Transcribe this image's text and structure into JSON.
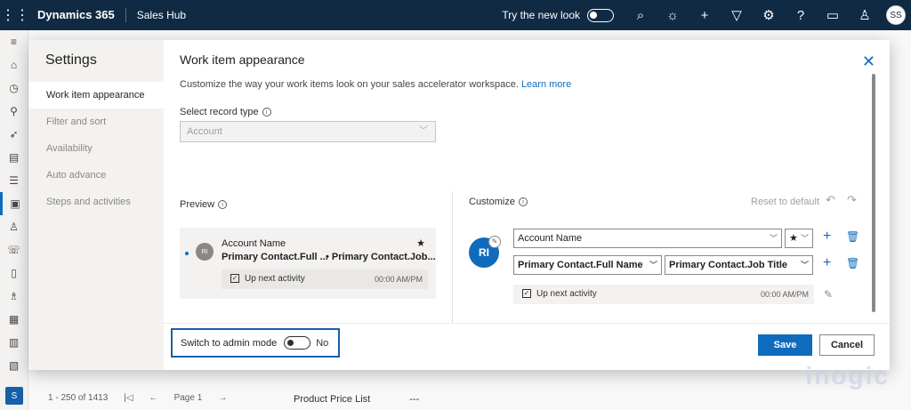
{
  "topbar": {
    "brand": "Dynamics 365",
    "app": "Sales Hub",
    "try_new_look": "Try the new look",
    "avatar": "SS",
    "icons": [
      "waffle-icon",
      "search-icon",
      "lightbulb-icon",
      "plus-icon",
      "filter-icon",
      "gear-icon",
      "help-icon",
      "chat-icon",
      "people-icon"
    ]
  },
  "leftnav": {
    "icons": [
      "hamburger-icon",
      "home-icon",
      "recent-icon",
      "pin-icon",
      "rocket-icon",
      "clipboard-icon",
      "list-icon",
      "workspace-icon",
      "person-icon",
      "phone-icon",
      "document-icon",
      "contact-icon",
      "report-icon",
      "doc-icon",
      "doc2-icon"
    ],
    "badge": "S"
  },
  "background": {
    "pager_count": "1 - 250 of 1413",
    "page": "Page 1",
    "field_label": "Product Price List",
    "field_value": "---"
  },
  "settings": {
    "title": "Settings",
    "items": [
      {
        "label": "Work item appearance",
        "active": true
      },
      {
        "label": "Filter and sort",
        "active": false
      },
      {
        "label": "Availability",
        "active": false
      },
      {
        "label": "Auto advance",
        "active": false
      },
      {
        "label": "Steps and activities",
        "active": false
      }
    ]
  },
  "main": {
    "title": "Work item appearance",
    "description": "Customize the way your work items look on your sales accelerator workspace.",
    "learn_more": "Learn more",
    "record_type_label": "Select record type",
    "record_type_value": "Account"
  },
  "preview": {
    "label": "Preview",
    "avatar": "RI",
    "name": "Account Name",
    "line2a": "Primary Contact.Full ...",
    "line2b": "• Primary Contact.Job...",
    "activity": "Up next activity",
    "time": "00:00 AM/PM"
  },
  "customize": {
    "label": "Customize",
    "reset": "Reset to default",
    "avatar": "RI",
    "field1": "Account Name",
    "field2": "Primary Contact.Full Name",
    "field3": "Primary Contact.Job Title",
    "activity": "Up next activity",
    "time": "00:00 AM/PM"
  },
  "footer": {
    "admin_label": "Switch to admin mode",
    "admin_state": "No",
    "save": "Save",
    "cancel": "Cancel"
  },
  "watermark": "inogic"
}
